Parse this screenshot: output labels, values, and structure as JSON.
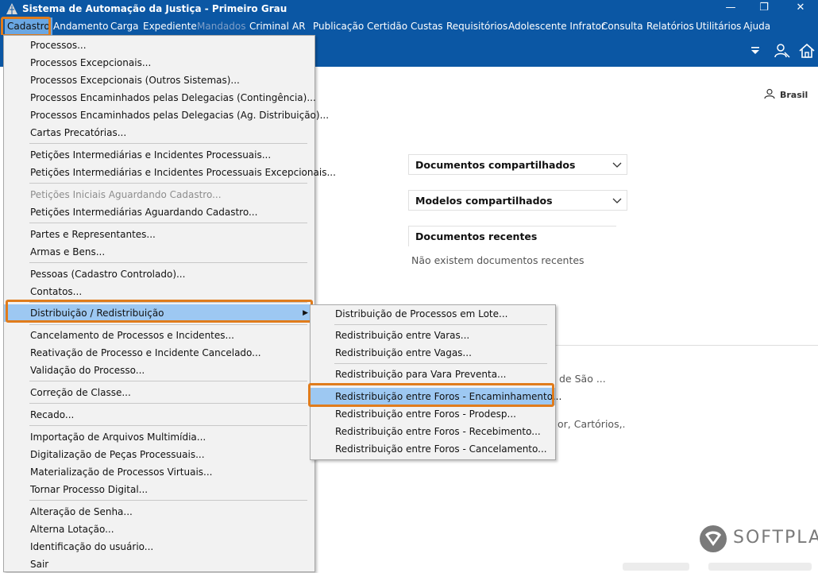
{
  "window": {
    "title": "Sistema de Automação da Justiça - Primeiro Grau",
    "minimize": "—",
    "restore": "❐",
    "close": "✕"
  },
  "menubar": [
    {
      "label": "Cadastro",
      "state": "active"
    },
    {
      "label": "Andamento"
    },
    {
      "label": "Carga"
    },
    {
      "label": "Expediente"
    },
    {
      "label": "Mandados",
      "state": "disabled"
    },
    {
      "label": "Criminal"
    },
    {
      "label": "AR"
    },
    {
      "label": "Publicação"
    },
    {
      "label": "Certidão"
    },
    {
      "label": "Custas"
    },
    {
      "label": "Requisitórios"
    },
    {
      "label": "Adolescente Infrator"
    },
    {
      "label": "Consulta"
    },
    {
      "label": "Relatórios"
    },
    {
      "label": "Utilitários"
    },
    {
      "label": "Ajuda"
    }
  ],
  "toolbar": {
    "icons": [
      "filter-icon",
      "user-switch-icon",
      "home-icon"
    ]
  },
  "content": {
    "user_locale": "Brasil",
    "panels": [
      {
        "label": "Documentos compartilhados",
        "icon": "chevron-down-icon"
      },
      {
        "label": "Modelos compartilhados",
        "icon": "chevron-down-icon"
      },
      {
        "label": "Documentos recentes"
      }
    ],
    "recent_empty": "Não existem documentos recentes",
    "fragment_1": "de São ...",
    "fragment_2": "or, Cartórios,."
  },
  "cadastro_menu": {
    "items": [
      "Processos...",
      "Processos Excepcionais...",
      "Processos Excepcionais (Outros Sistemas)...",
      "Processos Encaminhados pelas Delegacias (Contingência)...",
      "Processos Encaminhados pelas Delegacias (Ag. Distribuição)...",
      "Cartas Precatórias...",
      "Petições Intermediárias e Incidentes Processuais...",
      "Petições Intermediárias e Incidentes Processuais Excepcionais...",
      "Petições Iniciais Aguardando Cadastro...",
      "Petições Intermediárias Aguardando Cadastro...",
      "Partes e Representantes...",
      "Armas e Bens...",
      "Pessoas (Cadastro Controlado)...",
      "Contatos...",
      "Distribuição / Redistribuição",
      "Cancelamento de Processos e Incidentes...",
      "Reativação de Processo e Incidente Cancelado...",
      "Validação do Processo...",
      "Correção de Classe...",
      "Recado...",
      "Importação de Arquivos Multimídia...",
      "Digitalização de Peças Processuais...",
      "Materialização de Processos Virtuais...",
      "Tornar Processo Digital...",
      "Alteração de Senha...",
      "Alterna Lotação...",
      "Identificação do usuário...",
      "Sair"
    ],
    "disabled_item": "Petições Iniciais Aguardando Cadastro...",
    "selected_item": "Distribuição / Redistribuição"
  },
  "distribuicao_submenu": {
    "items": [
      "Distribuição de Processos em Lote...",
      "Redistribuição entre Varas...",
      "Redistribuição entre Vagas...",
      "Redistribuição para Vara Preventa...",
      "Redistribuição entre Foros - Encaminhamento...",
      "Redistribuição entre Foros - Prodesp...",
      "Redistribuição entre Foros - Recebimento...",
      "Redistribuição entre Foros - Cancelamento..."
    ],
    "selected_item": "Redistribuição entre Foros - Encaminhamento..."
  },
  "logo": {
    "text": "SOFTPLAN"
  },
  "colors": {
    "chrome_blue": "#0b57a4",
    "menu_bg": "#f2f2f2",
    "selection": "#9dc8f2",
    "highlight_orange": "#e07c1c"
  }
}
